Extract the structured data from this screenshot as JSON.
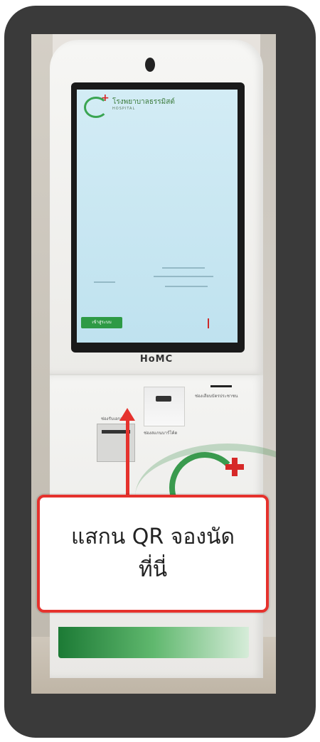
{
  "brand": "HoMC",
  "screen": {
    "hospital_name": "โรงพยาบาลธรรมิสต์",
    "hospital_sub": "HOSPITAL",
    "button_label": "เข้าสู่ระบบ"
  },
  "kiosk_labels": {
    "receipt_label": "ช่องรับเอกสาร",
    "qr_label": "ช่องสแกนบาร์โค้ด",
    "card_slot_label": "ช่องเสียบบัตรประชาชน"
  },
  "callout": {
    "line1": "แสกน QR จองนัด",
    "line2": "ที่นี่"
  },
  "colors": {
    "accent": "#e5322d",
    "brand_green": "#2e9a45"
  }
}
